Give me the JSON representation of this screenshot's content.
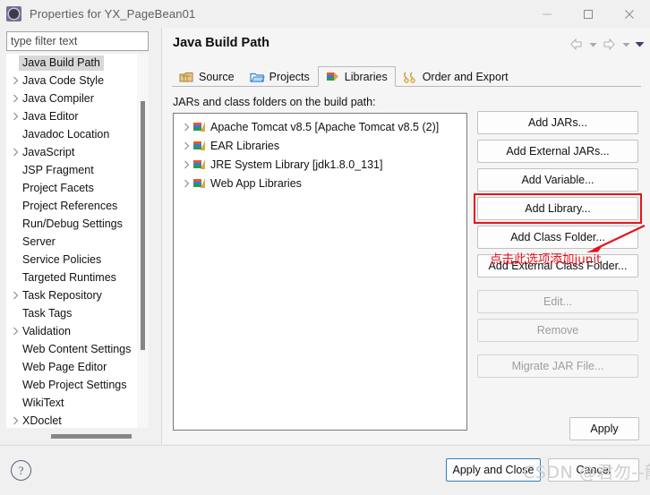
{
  "window": {
    "title": "Properties for YX_PageBean01",
    "icon": "eclipse-properties-icon",
    "minimize_label": "—",
    "maximize_label": "□",
    "close_label": "✕"
  },
  "sidebar": {
    "filter": {
      "value": "",
      "placeholder": "type filter text"
    },
    "items": [
      {
        "label": "Java Build Path",
        "expandable": false,
        "selected": true
      },
      {
        "label": "Java Code Style",
        "expandable": true,
        "selected": false
      },
      {
        "label": "Java Compiler",
        "expandable": true,
        "selected": false
      },
      {
        "label": "Java Editor",
        "expandable": true,
        "selected": false
      },
      {
        "label": "Javadoc Location",
        "expandable": false,
        "selected": false
      },
      {
        "label": "JavaScript",
        "expandable": true,
        "selected": false
      },
      {
        "label": "JSP Fragment",
        "expandable": false,
        "selected": false
      },
      {
        "label": "Project Facets",
        "expandable": false,
        "selected": false
      },
      {
        "label": "Project References",
        "expandable": false,
        "selected": false
      },
      {
        "label": "Run/Debug Settings",
        "expandable": false,
        "selected": false
      },
      {
        "label": "Server",
        "expandable": false,
        "selected": false
      },
      {
        "label": "Service Policies",
        "expandable": false,
        "selected": false
      },
      {
        "label": "Targeted Runtimes",
        "expandable": false,
        "selected": false
      },
      {
        "label": "Task Repository",
        "expandable": true,
        "selected": false
      },
      {
        "label": "Task Tags",
        "expandable": false,
        "selected": false
      },
      {
        "label": "Validation",
        "expandable": true,
        "selected": false
      },
      {
        "label": "Web Content Settings",
        "expandable": false,
        "selected": false
      },
      {
        "label": "Web Page Editor",
        "expandable": false,
        "selected": false
      },
      {
        "label": "Web Project Settings",
        "expandable": false,
        "selected": false
      },
      {
        "label": "WikiText",
        "expandable": false,
        "selected": false
      },
      {
        "label": "XDoclet",
        "expandable": true,
        "selected": false
      }
    ]
  },
  "main": {
    "title": "Java Build Path",
    "nav": {
      "back_icon": "back-arrow-icon",
      "back_menu_icon": "chevron-down-icon",
      "forward_icon": "forward-arrow-icon",
      "forward_menu_icon": "chevron-down-icon",
      "view_menu_icon": "chevron-down-icon"
    },
    "tabs": [
      {
        "label": "Source",
        "icon": "source-folder-icon",
        "active": false
      },
      {
        "label": "Projects",
        "icon": "projects-folder-icon",
        "active": false
      },
      {
        "label": "Libraries",
        "icon": "libraries-books-icon",
        "active": true
      },
      {
        "label": "Order and Export",
        "icon": "order-export-icon",
        "active": false
      }
    ],
    "section_label": "JARs and class folders on the build path:",
    "libraries": [
      {
        "label": "Apache Tomcat v8.5 [Apache Tomcat v8.5 (2)]",
        "icon": "libraries-books-icon"
      },
      {
        "label": "EAR Libraries",
        "icon": "libraries-books-icon"
      },
      {
        "label": "JRE System Library [jdk1.8.0_131]",
        "icon": "libraries-books-icon"
      },
      {
        "label": "Web App Libraries",
        "icon": "libraries-books-icon"
      }
    ],
    "side_buttons": [
      {
        "label": "Add JARs...",
        "enabled": true,
        "highlighted": false,
        "gap_before": false
      },
      {
        "label": "Add External JARs...",
        "enabled": true,
        "highlighted": false,
        "gap_before": false
      },
      {
        "label": "Add Variable...",
        "enabled": true,
        "highlighted": false,
        "gap_before": false
      },
      {
        "label": "Add Library...",
        "enabled": true,
        "highlighted": true,
        "gap_before": false
      },
      {
        "label": "Add Class Folder...",
        "enabled": true,
        "highlighted": false,
        "gap_before": false
      },
      {
        "label": "Add External Class Folder...",
        "enabled": true,
        "highlighted": false,
        "gap_before": false
      },
      {
        "label": "Edit...",
        "enabled": false,
        "highlighted": false,
        "gap_before": true
      },
      {
        "label": "Remove",
        "enabled": false,
        "highlighted": false,
        "gap_before": false
      },
      {
        "label": "Migrate JAR File...",
        "enabled": false,
        "highlighted": false,
        "gap_before": true
      }
    ],
    "apply_label": "Apply"
  },
  "annotation": {
    "text": "点击此选项添加junit",
    "color": "#e8131b",
    "arrow_icon": "pointer-arrow-icon"
  },
  "footer": {
    "help_label": "?",
    "apply_and_close_label": "Apply and Close",
    "cancel_label": "Cancel"
  },
  "watermark": {
    "text": "CSDN @君勿--龍"
  }
}
